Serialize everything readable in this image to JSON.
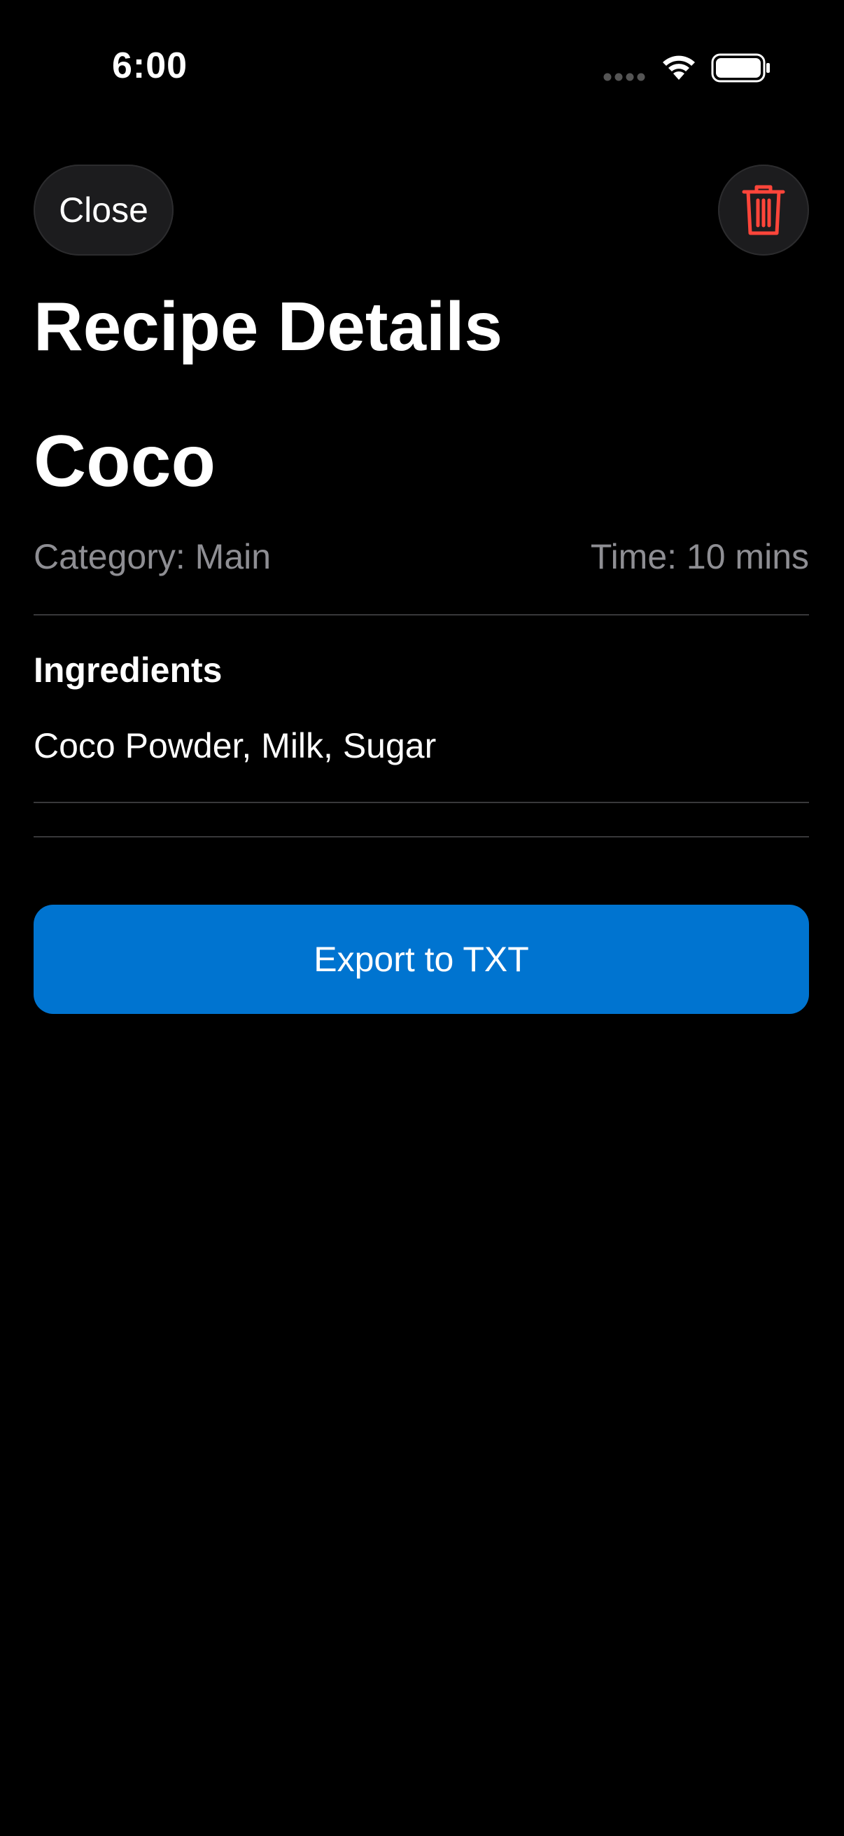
{
  "status_bar": {
    "time": "6:00"
  },
  "toolbar": {
    "close_label": "Close",
    "delete_icon": "trash-icon",
    "delete_color": "#ff453a"
  },
  "page": {
    "title": "Recipe Details"
  },
  "recipe": {
    "name": "Coco",
    "category": "Category: Main",
    "time": "Time: 10 mins",
    "ingredients_heading": "Ingredients",
    "ingredients": "Coco Powder, Milk, Sugar"
  },
  "actions": {
    "export_label": "Export to TXT",
    "export_color": "#0074d0"
  }
}
